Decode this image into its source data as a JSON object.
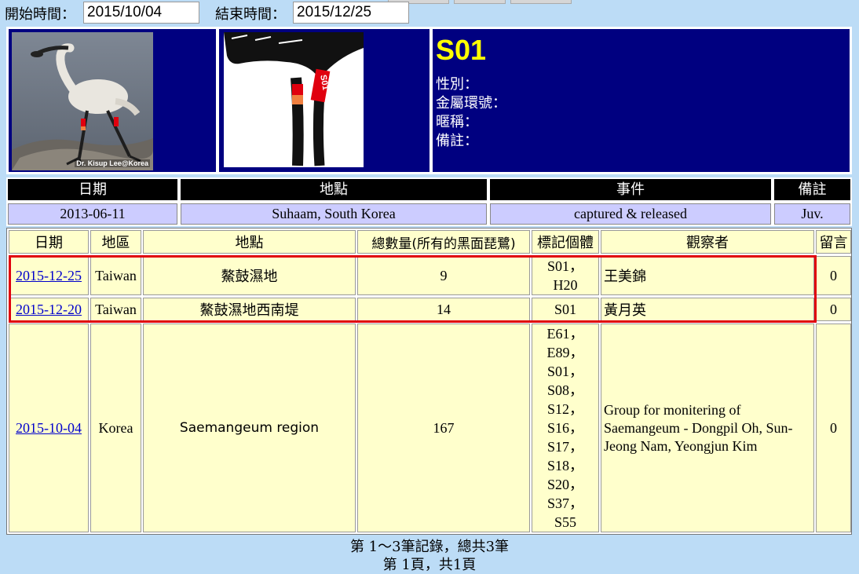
{
  "filter": {
    "start_label": "開始時間：",
    "start_value": "2015/10/04",
    "end_label": "結束時間：",
    "end_value": "2015/12/25"
  },
  "profile": {
    "band_id": "S01",
    "photo_credit": "Dr. Kisup Lee@Korea",
    "tag_label": "S01",
    "fields": [
      "性別：",
      "金屬環號：",
      "暱稱：",
      "備註："
    ],
    "colors": {
      "panel_bg": "#000080",
      "band_text": "#ffff00",
      "tag_red": "#e0000e",
      "tag_orange": "#f08040"
    }
  },
  "capture_event": {
    "headers": [
      "日期",
      "地點",
      "事件",
      "備註"
    ],
    "values": [
      "2013-06-11",
      "Suhaam, South Korea",
      "captured & released",
      "Juv."
    ]
  },
  "observations": {
    "headers": [
      "日期",
      "地區",
      "地點",
      "總數量(所有的黑面琵鷺)",
      "標記個體",
      "觀察者",
      "留言"
    ],
    "rows": [
      {
        "date": "2015-12-25",
        "region": "Taiwan",
        "location": "鰲鼓濕地",
        "count": "9",
        "marks": [
          "S01，",
          "H20"
        ],
        "observer": "王美錦",
        "comments": "0"
      },
      {
        "date": "2015-12-20",
        "region": "Taiwan",
        "location": "鰲鼓濕地西南堤",
        "count": "14",
        "marks": [
          "S01"
        ],
        "observer": "黃月英",
        "comments": "0"
      },
      {
        "date": "2015-10-04",
        "region": "Korea",
        "location": "Saemangeum region",
        "count": "167",
        "marks": [
          "E61，",
          "E89，",
          "S01，",
          "S08，",
          "S12，",
          "S16，",
          "S17，",
          "S18，",
          "S20，",
          "S37，",
          "S55"
        ],
        "observer": "Group for monitering of Saemangeum - Dongpil Oh, Sun-Jeong Nam, Yeongjun Kim",
        "comments": "0"
      }
    ],
    "highlight_color": "#e0000e"
  },
  "pagination": {
    "records": "第 1～3筆記錄，總共3筆",
    "pages": "第 1頁，共1頁"
  }
}
